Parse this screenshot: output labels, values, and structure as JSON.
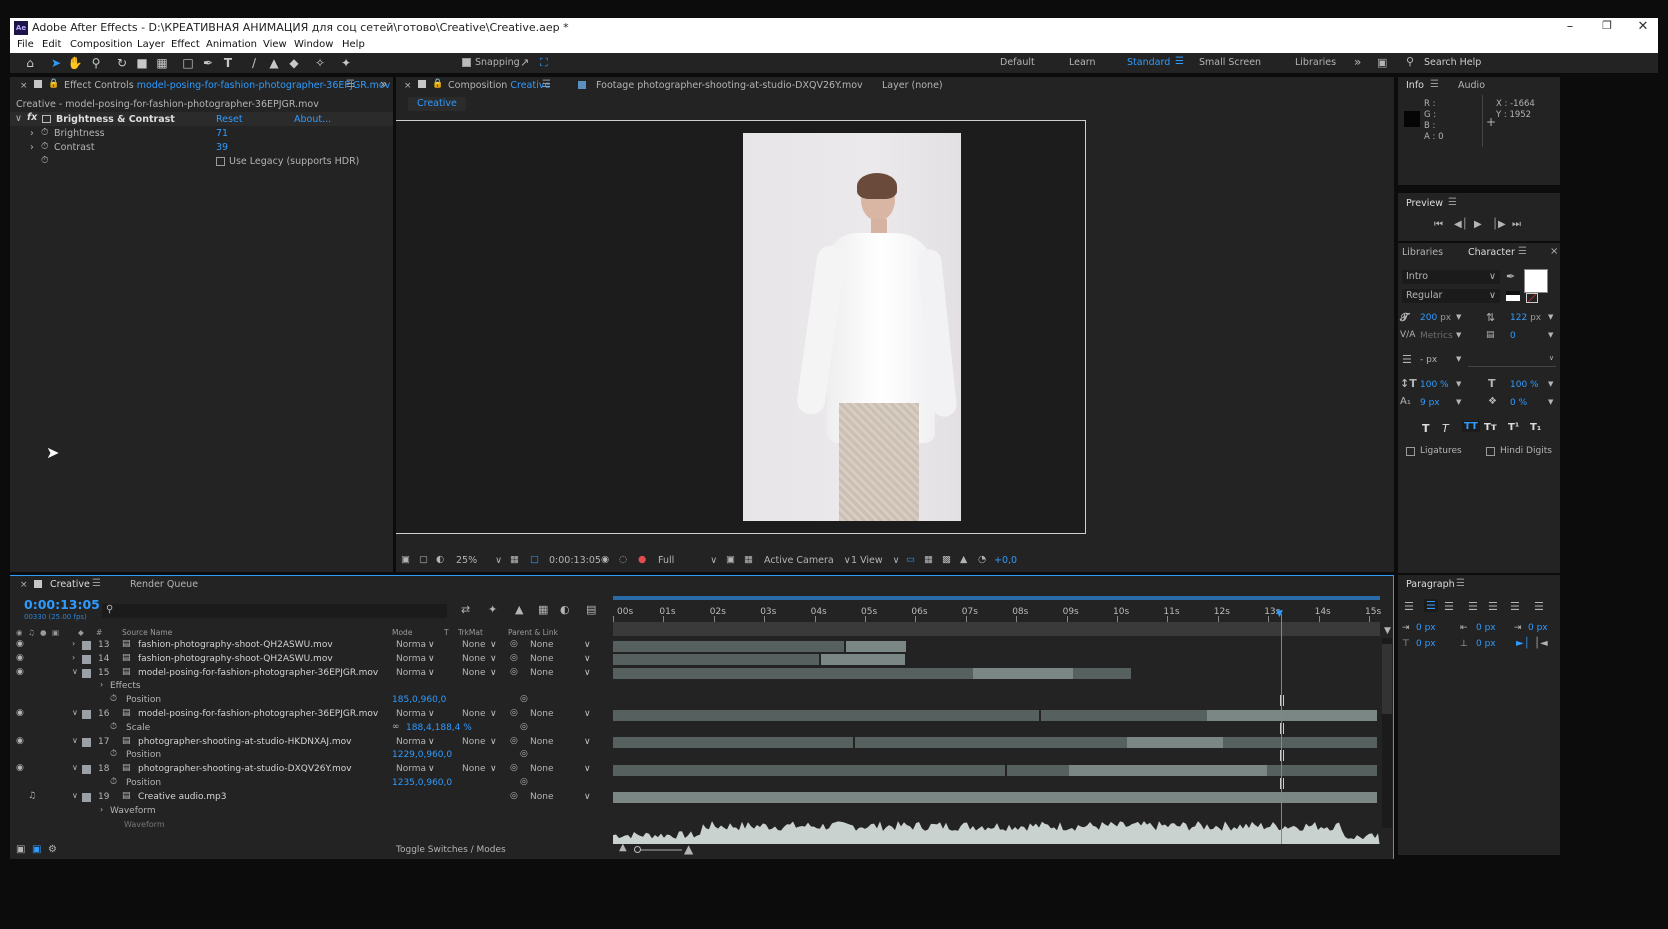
{
  "app": {
    "logo": "Ae",
    "title": "Adobe After Effects - D:\\КРЕАТИВНАЯ АНИМАЦИЯ для соц сетей\\готово\\Creative\\Creative.aep *"
  },
  "menu": [
    "File",
    "Edit",
    "Composition",
    "Layer",
    "Effect",
    "Animation",
    "View",
    "Window",
    "Help"
  ],
  "toolbar": {
    "snapping": "Snapping",
    "workspaces": [
      "Default",
      "Learn",
      "Standard",
      "Small Screen",
      "Libraries"
    ],
    "active_workspace": "Standard",
    "search_placeholder": "Search Help"
  },
  "effect_controls": {
    "tab_prefix": "Effect Controls",
    "tab_layer": "model-posing-for-fashion-photographer-36EPJGR.mov",
    "path": "Creative - model-posing-for-fashion-photographer-36EPJGR.mov",
    "effect_name": "Brightness & Contrast",
    "reset": "Reset",
    "about": "About...",
    "brightness_label": "Brightness",
    "brightness_value": "71",
    "contrast_label": "Contrast",
    "contrast_value": "39",
    "legacy_label": "Use Legacy (supports HDR)"
  },
  "viewer": {
    "comp_tab_prefix": "Composition",
    "comp_tab_name": "Creative",
    "footage_tab": "Footage  photographer-shooting-at-studio-DXQV26Y.mov",
    "layer_tab": "Layer  (none)",
    "comp_flow": "Creative",
    "zoom": "25%",
    "timecode": "0:00:13:05",
    "resolution": "Full",
    "camera": "Active Camera",
    "views": "1 View",
    "exposure": "+0,0"
  },
  "info": {
    "tab": "Info",
    "tab2": "Audio",
    "r": "R :",
    "g": "G :",
    "b": "B :",
    "a": "A : 0",
    "x": "X : -1664",
    "y": "Y : 1952"
  },
  "preview": {
    "title": "Preview"
  },
  "character": {
    "tab1": "Libraries",
    "tab2": "Character",
    "font": "Intro",
    "style": "Regular",
    "size": "200",
    "size_unit": "px",
    "leading": "122",
    "leading_unit": "px",
    "kerning": "Metrics",
    "tracking": "0",
    "stroke": "- px",
    "vscale": "100 %",
    "hscale": "100 %",
    "baseline": "9 px",
    "tsume": "0 %",
    "ligatures": "Ligatures",
    "hindi": "Hindi Digits"
  },
  "paragraph": {
    "title": "Paragraph",
    "indent1": "0 px",
    "indent2": "0 px",
    "indent3": "0 px",
    "space1": "0 px",
    "space2": "0 px"
  },
  "timeline": {
    "tab": "Creative",
    "render_queue": "Render Queue",
    "timecode": "0:00:13:05",
    "frames": "00330 (25.00 fps)",
    "col_num": "#",
    "col_source": "Source Name",
    "col_mode": "Mode",
    "col_t": "T",
    "col_trkmat": "TrkMat",
    "col_parent": "Parent & Link",
    "ruler": [
      "00s",
      "01s",
      "02s",
      "03s",
      "04s",
      "05s",
      "06s",
      "07s",
      "08s",
      "09s",
      "10s",
      "11s",
      "12s",
      "13s",
      "14s",
      "15s"
    ],
    "layers": [
      {
        "num": "13",
        "name": "fashion-photography-shoot-QH2ASWU.mov",
        "mode": "Norma",
        "trk": "None",
        "parent": "None"
      },
      {
        "num": "14",
        "name": "fashion-photography-shoot-QH2ASWU.mov",
        "mode": "Norma",
        "trk": "None",
        "parent": "None"
      },
      {
        "num": "15",
        "name": "model-posing-for-fashion-photographer-36EPJGR.mov",
        "mode": "Norma",
        "trk": "None",
        "parent": "None"
      },
      {
        "num": "16",
        "name": "model-posing-for-fashion-photographer-36EPJGR.mov",
        "mode": "Norma",
        "trk": "None",
        "parent": "None"
      },
      {
        "num": "17",
        "name": "photographer-shooting-at-studio-HKDNXAJ.mov",
        "mode": "Norma",
        "trk": "None",
        "parent": "None"
      },
      {
        "num": "18",
        "name": "photographer-shooting-at-studio-DXQV26Y.mov",
        "mode": "Norma",
        "trk": "None",
        "parent": "None"
      },
      {
        "num": "19",
        "name": "Creative audio.mp3",
        "parent": "None"
      }
    ],
    "effects_label": "Effects",
    "position_label": "Position",
    "scale_label": "Scale",
    "pos15": "185,0,960,0",
    "scale16": "188,4,188,4 %",
    "pos17": "1229,0,960,0",
    "pos18": "1235,0,960,0",
    "waveform_label": "Waveform",
    "waveform_label2": "Waveform",
    "toggle": "Toggle Switches / Modes"
  },
  "colors": {
    "accent": "#2f9bff",
    "panel": "#232323",
    "background": "#0c0c0c"
  }
}
